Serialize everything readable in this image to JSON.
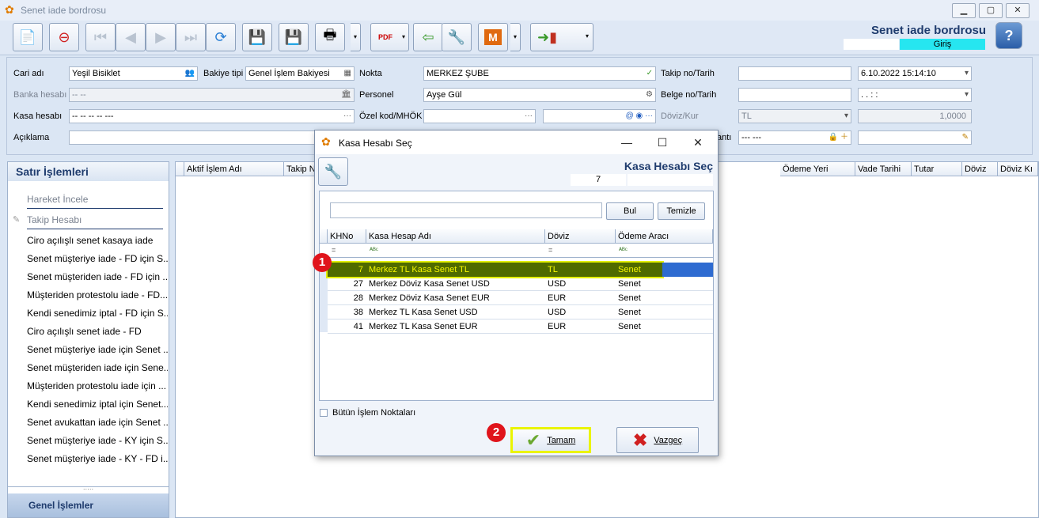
{
  "window": {
    "title": "Senet iade bordrosu"
  },
  "header": {
    "title": "Senet iade bordrosu",
    "mode": "Giriş"
  },
  "form": {
    "cari_label": "Cari adı",
    "cari_value": "Yeşil Bisiklet",
    "bakiye_label": "Bakiye tipi",
    "bakiye_value": "Genel İşlem Bakiyesi",
    "nokta_label": "Nokta",
    "nokta_value": "MERKEZ ŞUBE",
    "takip_label": "Takip no/Tarih",
    "takip_value": "",
    "tarih_value": "6.10.2022 15:14:10",
    "banka_label": "Banka hesabı",
    "banka_value": "-- --",
    "personel_label": "Personel",
    "personel_value": "Ayşe Gül",
    "belge_label": "Belge no/Tarih",
    "belge_value": "",
    "belge_tarih_value": ".  .     :  :",
    "kasa_label": "Kasa hesabı",
    "kasa_value": "-- -- -- -- ---",
    "ozel_label": "Özel kod/MHÖK",
    "doviz_label": "Döviz/Kur",
    "doviz_value": "TL",
    "kur_value": "1,0000",
    "aciklama_label": "Açıklama",
    "anti_label": "antı",
    "anti_value": "--- ---"
  },
  "left_panel": {
    "title": "Satır İşlemleri",
    "items": [
      "Hareket İncele",
      "Takip Hesabı",
      "Ciro açılışlı senet kasaya iade",
      "Senet müşteriye iade - FD için S...",
      "Senet müşteriden iade - FD için ...",
      "Müşteriden protestolu iade - FD...",
      "Kendi senedimiz iptal - FD için S...",
      "Ciro açılışlı senet iade - FD",
      "Senet müşteriye iade için Senet ...",
      "Senet müşteriden iade için Sene...",
      "Müşteriden protestolu iade için ...",
      "Kendi senedimiz iptal için Senet...",
      "Senet avukattan iade için Senet ...",
      "Senet müşteriye iade - KY için S...",
      "Senet müşteriye iade - KY - FD i..."
    ],
    "footer": "Genel İşlemler"
  },
  "grid": {
    "columns": [
      "Aktif İşlem Adı",
      "Takip No",
      "Ödeme Yeri",
      "Vade Tarihi",
      "Tutar",
      "Döviz",
      "Döviz Kı"
    ]
  },
  "dialog": {
    "title": "Kasa Hesabı Seç",
    "header_title": "Kasa Hesabı Seç",
    "header_value": "7",
    "search_value": "",
    "find_button": "Bul",
    "clear_button": "Temizle",
    "columns": [
      "KHNo",
      "Kasa Hesap Adı",
      "Döviz",
      "Ödeme Aracı"
    ],
    "filter_row": [
      "=",
      "ᴬᴮᶜ",
      "=",
      "ᴬᴮᶜ"
    ],
    "rows": [
      {
        "no": "7",
        "name": "Merkez TL Kasa Senet TL",
        "currency": "TL",
        "method": "Senet"
      },
      {
        "no": "27",
        "name": "Merkez Döviz Kasa Senet USD",
        "currency": "USD",
        "method": "Senet"
      },
      {
        "no": "28",
        "name": "Merkez Döviz Kasa Senet EUR",
        "currency": "EUR",
        "method": "Senet"
      },
      {
        "no": "38",
        "name": "Merkez TL Kasa Senet USD",
        "currency": "USD",
        "method": "Senet"
      },
      {
        "no": "41",
        "name": "Merkez TL Kasa Senet EUR",
        "currency": "EUR",
        "method": "Senet"
      }
    ],
    "all_points_label": "Bütün İşlem Noktaları",
    "ok_button": "Tamam",
    "cancel_button": "Vazgeç"
  },
  "annotations": {
    "badge1": "1",
    "badge2": "2"
  },
  "colors": {
    "highlight": "#4f6a00",
    "highlight_text": "#f7f700",
    "selection": "#2e6bd1",
    "accent": "#1f3c6e"
  }
}
